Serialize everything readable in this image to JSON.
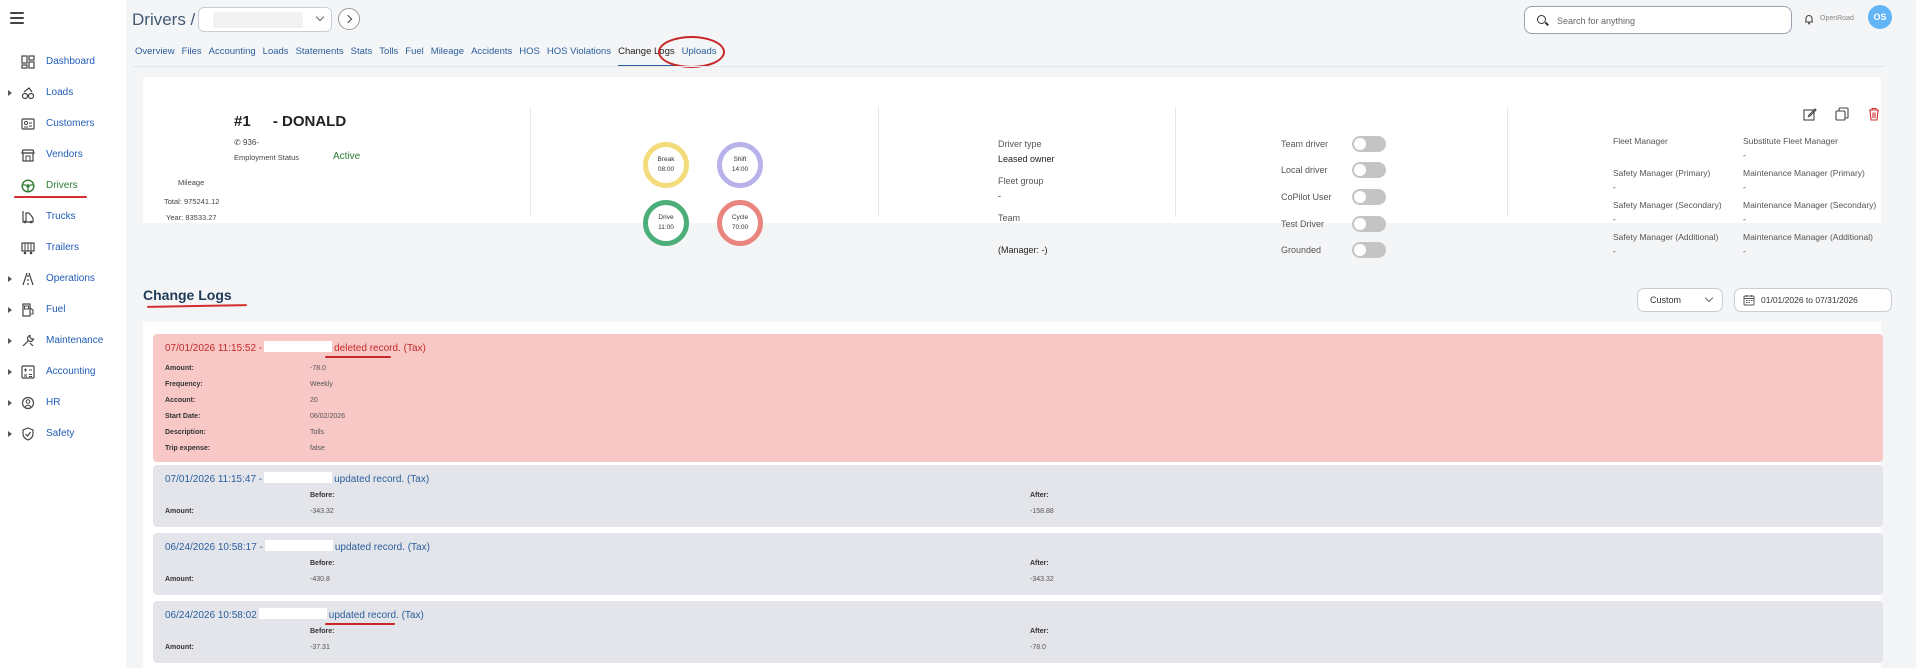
{
  "sidebar": {
    "items": [
      {
        "label": "Dashboard",
        "icon": "dashboard-icon",
        "expandable": false
      },
      {
        "label": "Loads",
        "icon": "loads-icon",
        "expandable": true
      },
      {
        "label": "Customers",
        "icon": "customers-icon",
        "expandable": false
      },
      {
        "label": "Vendors",
        "icon": "vendors-icon",
        "expandable": false
      },
      {
        "label": "Drivers",
        "icon": "drivers-icon",
        "expandable": false,
        "active": true
      },
      {
        "label": "Trucks",
        "icon": "trucks-icon",
        "expandable": false
      },
      {
        "label": "Trailers",
        "icon": "trailers-icon",
        "expandable": false
      },
      {
        "label": "Operations",
        "icon": "operations-icon",
        "expandable": true
      },
      {
        "label": "Fuel",
        "icon": "fuel-icon",
        "expandable": true
      },
      {
        "label": "Maintenance",
        "icon": "maintenance-icon",
        "expandable": true
      },
      {
        "label": "Accounting",
        "icon": "accounting-icon",
        "expandable": true
      },
      {
        "label": "HR",
        "icon": "hr-icon",
        "expandable": true
      },
      {
        "label": "Safety",
        "icon": "safety-icon",
        "expandable": true
      }
    ]
  },
  "header": {
    "title": "Drivers /",
    "search_placeholder": "Search for anything",
    "org_name": "OpenRoad",
    "avatar_initials": "OS"
  },
  "tabs": [
    "Overview",
    "Files",
    "Accounting",
    "Loads",
    "Statements",
    "Stats",
    "Tolls",
    "Fuel",
    "Mileage",
    "Accidents",
    "HOS",
    "HOS Violations",
    "Change Logs",
    "Uploads"
  ],
  "active_tab": "Change Logs",
  "driver": {
    "number": "#1",
    "name": "- DONALD",
    "phone": "936-",
    "employment_status_label": "Employment Status",
    "employment_status": "Active",
    "mileage_label": "Mileage",
    "mileage_total": "Total: 975241.12",
    "mileage_year": "Year: 83533.27"
  },
  "hos": [
    {
      "label": "Break",
      "value": "08:00",
      "color": "#f2dc7c"
    },
    {
      "label": "Shift",
      "value": "14:00",
      "color": "#b7b2ea"
    },
    {
      "label": "Drive",
      "value": "11:00",
      "color": "#4caf7a"
    },
    {
      "label": "Cycle",
      "value": "70:00",
      "color": "#e9847f"
    }
  ],
  "driver_info": {
    "type_label": "Driver type",
    "type_value": "Leased owner",
    "fleet_group_label": "Fleet group",
    "fleet_group_value": "-",
    "team_label": "Team",
    "manager_value": "(Manager: -)"
  },
  "flags": [
    {
      "label": "Team driver"
    },
    {
      "label": "Local driver"
    },
    {
      "label": "CoPilot User"
    },
    {
      "label": "Test Driver"
    },
    {
      "label": "Grounded"
    }
  ],
  "managers": [
    {
      "label": "Fleet Manager",
      "value": ""
    },
    {
      "label": "Substitute Fleet Manager",
      "value": "-"
    },
    {
      "label": "Safety Manager (Primary)",
      "value": "-"
    },
    {
      "label": "Maintenance Manager (Primary)",
      "value": "-"
    },
    {
      "label": "Safety Manager (Secondary)",
      "value": "-"
    },
    {
      "label": "Maintenance Manager (Secondary)",
      "value": "-"
    },
    {
      "label": "Safety Manager (Additional)",
      "value": "-"
    },
    {
      "label": "Maintenance Manager (Additional)",
      "value": "-"
    }
  ],
  "change_logs": {
    "title": "Change Logs",
    "range_option": "Custom",
    "date_range": "01/01/2026 to 07/31/2026",
    "entries": [
      {
        "timestamp": "07/01/2026 11:15:52 -",
        "action": "deleted record. (Tax)",
        "type": "deleted",
        "fields": [
          {
            "label": "Amount:",
            "value": "-78.0"
          },
          {
            "label": "Frequency:",
            "value": "Weekly"
          },
          {
            "label": "Account:",
            "value": "20"
          },
          {
            "label": "Start Date:",
            "value": "06/02/2026"
          },
          {
            "label": "Description:",
            "value": "Tolls"
          },
          {
            "label": "Trip expense:",
            "value": "false"
          }
        ]
      },
      {
        "timestamp": "07/01/2026 11:15:47 -",
        "action": "updated record. (Tax)",
        "type": "updated",
        "before_label": "Before:",
        "after_label": "After:",
        "field_label": "Amount:",
        "before": "-343.32",
        "after": "-158.88"
      },
      {
        "timestamp": "06/24/2026 10:58:17 -",
        "action": "updated record. (Tax)",
        "type": "updated",
        "before_label": "Before:",
        "after_label": "After:",
        "field_label": "Amount:",
        "before": "-430.8",
        "after": "-343.32"
      },
      {
        "timestamp": "06/24/2026 10:58:02",
        "action": "updated record. (Tax)",
        "type": "updated",
        "before_label": "Before:",
        "after_label": "After:",
        "field_label": "Amount:",
        "before": "-37.31",
        "after": "-78.0"
      }
    ]
  }
}
